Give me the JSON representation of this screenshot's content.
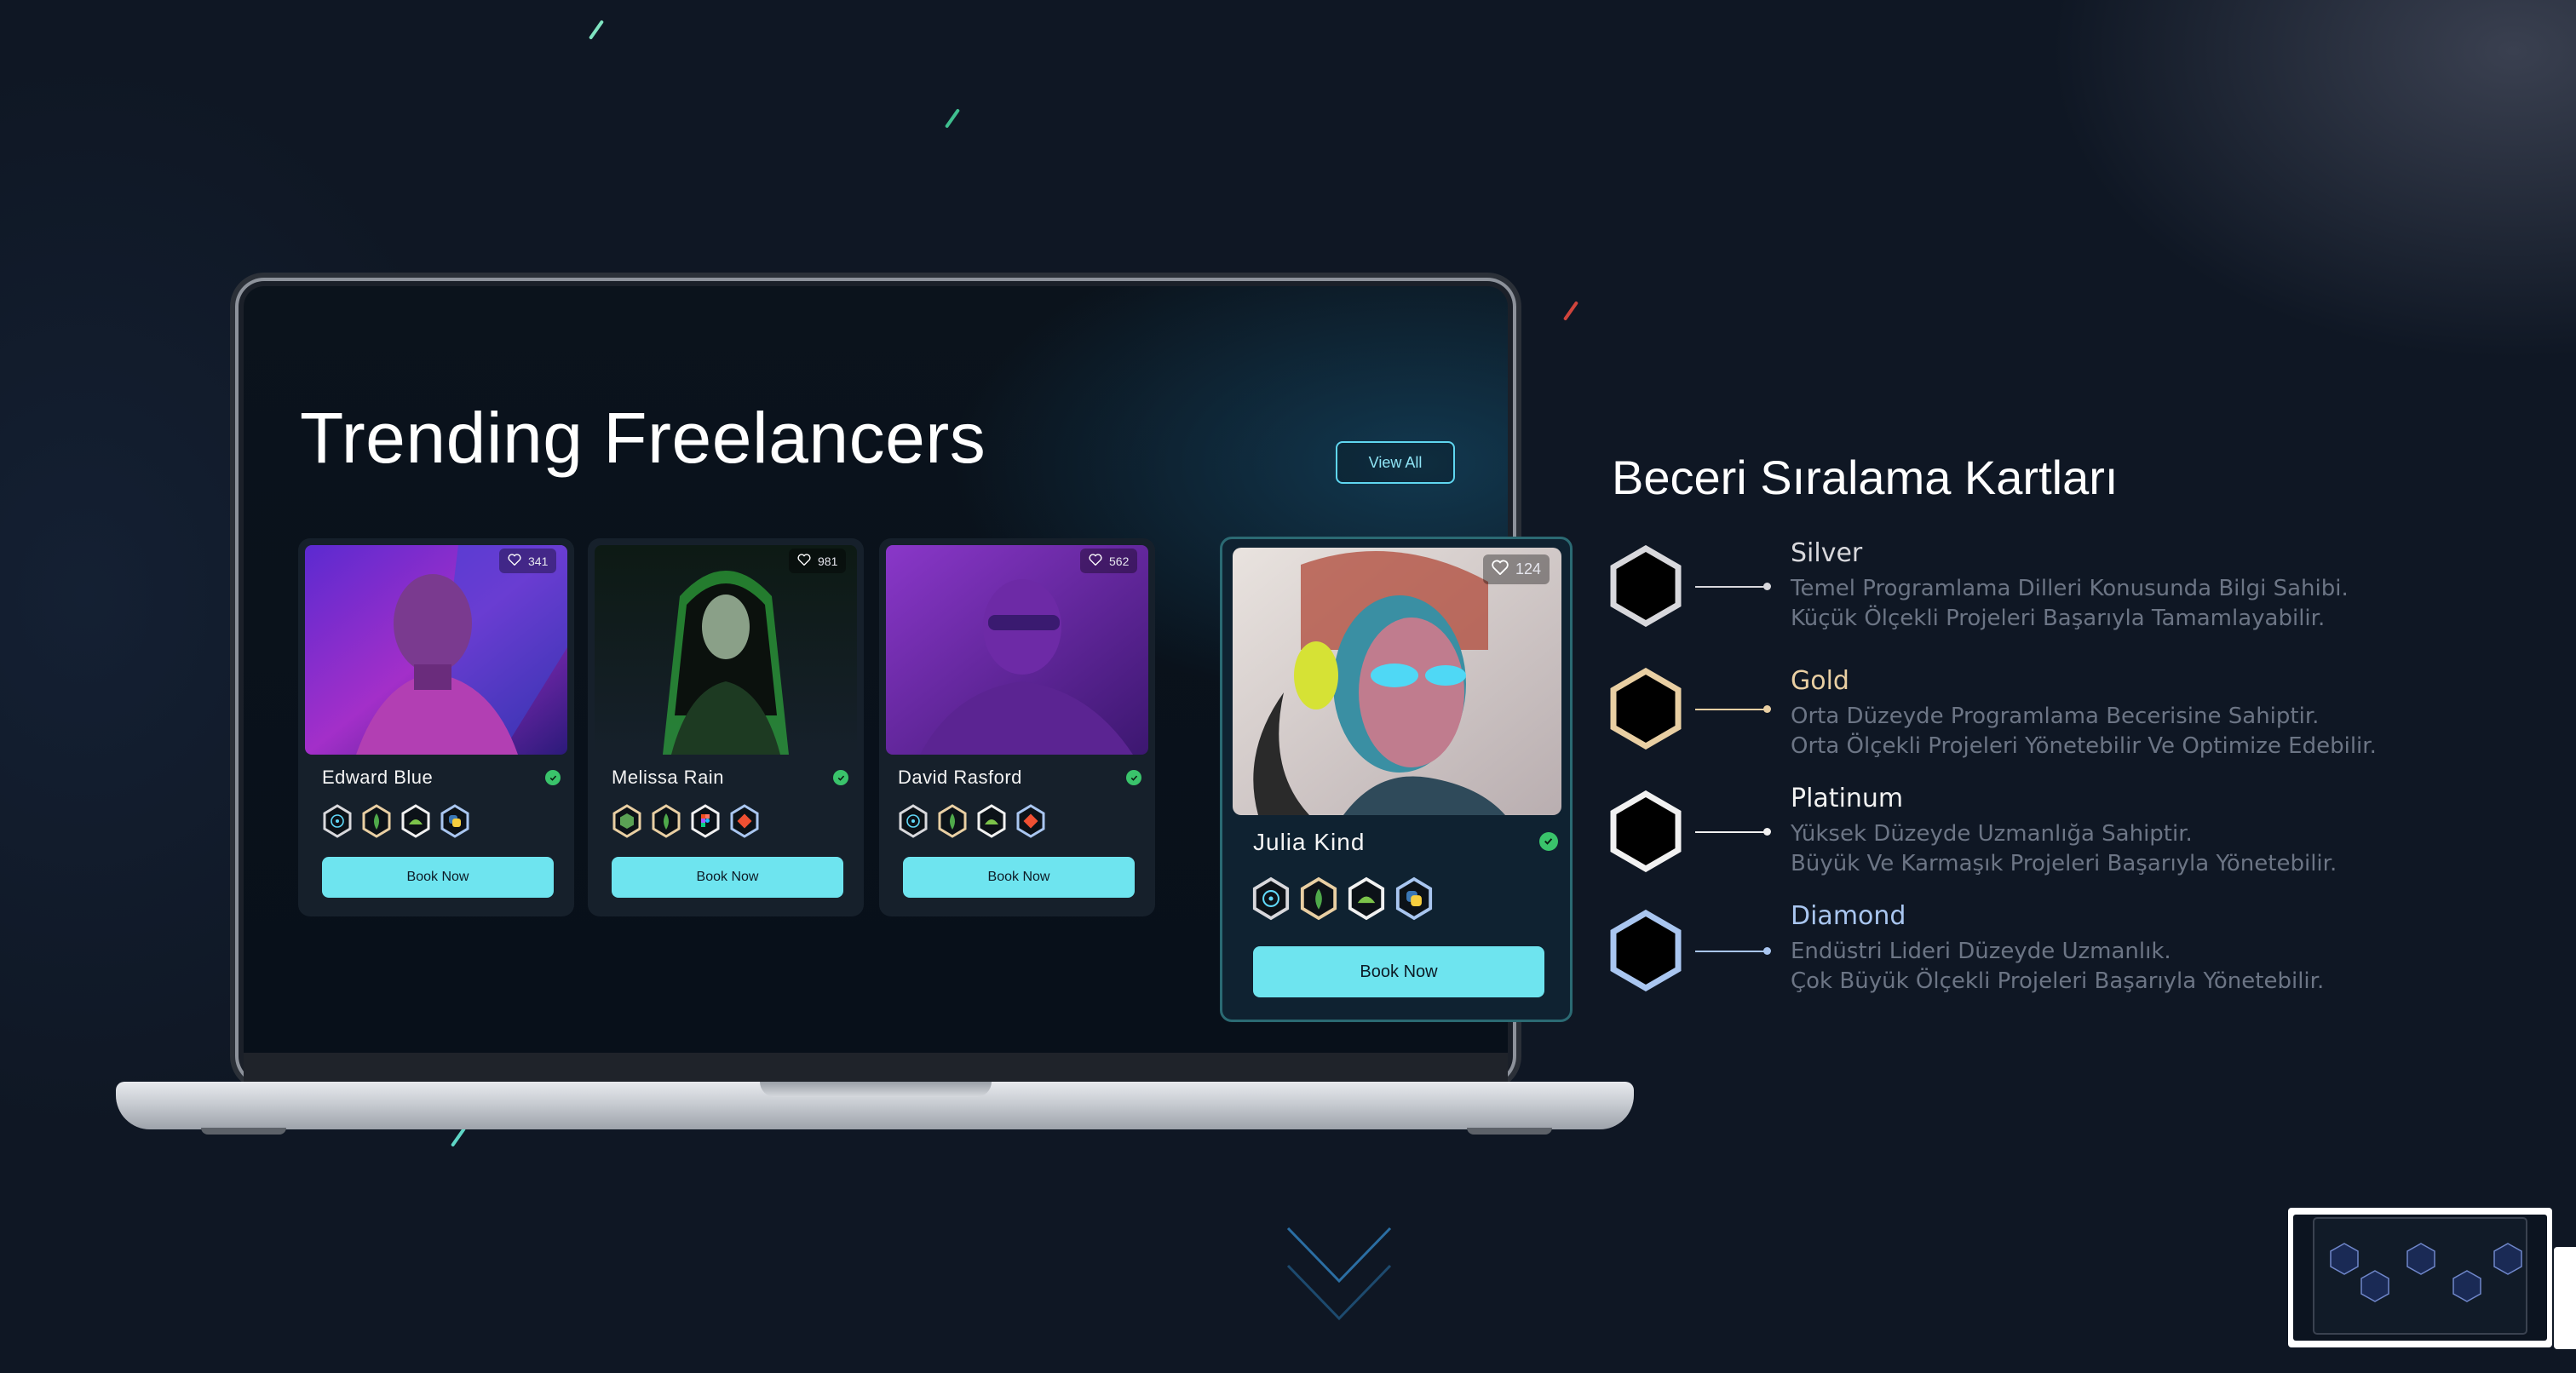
{
  "screen": {
    "title": "Trending Freelancers",
    "view_all_label": "View All"
  },
  "cards": [
    {
      "name": "Edward Blue",
      "likes": "341",
      "book_label": "Book Now",
      "badges": [
        "react-icon",
        "node-icon",
        "android-icon",
        "python-icon"
      ]
    },
    {
      "name": "Melissa Rain",
      "likes": "981",
      "book_label": "Book Now",
      "badges": [
        "node-icon",
        "mongodb-icon",
        "figma-icon",
        "git-icon"
      ]
    },
    {
      "name": "David Rasford",
      "likes": "562",
      "book_label": "Book Now",
      "badges": [
        "react-icon",
        "mongodb-icon",
        "android-icon",
        "git-icon"
      ]
    }
  ],
  "featured": {
    "name": "Julia Kind",
    "likes": "124",
    "book_label": "Book Now",
    "badges": [
      "react-icon",
      "mongodb-icon",
      "android-icon",
      "python-icon"
    ]
  },
  "panel": {
    "title": "Beceri Sıralama Kartları",
    "tiers": [
      {
        "name": "Silver",
        "color": "#d8d8dc",
        "line1": "Temel Programlama Dilleri Konusunda Bilgi Sahibi.",
        "line2": "Küçük Ölçekli Projeleri Başarıyla Tamamlayabilir."
      },
      {
        "name": "Gold",
        "color": "#e9cfa3",
        "line1": "Orta Düzeyde Programlama Becerisine Sahiptir.",
        "line2": "Orta Ölçekli Projeleri Yönetebilir Ve Optimize Edebilir."
      },
      {
        "name": "Platinum",
        "color": "#f1f1f1",
        "line1": "Yüksek Düzeyde Uzmanlığa Sahiptir.",
        "line2": "Büyük Ve Karmaşık Projeleri Başarıyla Yönetebilir."
      },
      {
        "name": "Diamond",
        "color": "#a9c6f0",
        "line1": "Endüstri Lideri Düzeyde Uzmanlık.",
        "line2": "Çok Büyük Ölçekli Projeleri Başarıyla Yönetebilir."
      }
    ]
  },
  "colors": {
    "accent": "#6ee4ef",
    "verified": "#3ac36b",
    "background": "#0f1724"
  }
}
